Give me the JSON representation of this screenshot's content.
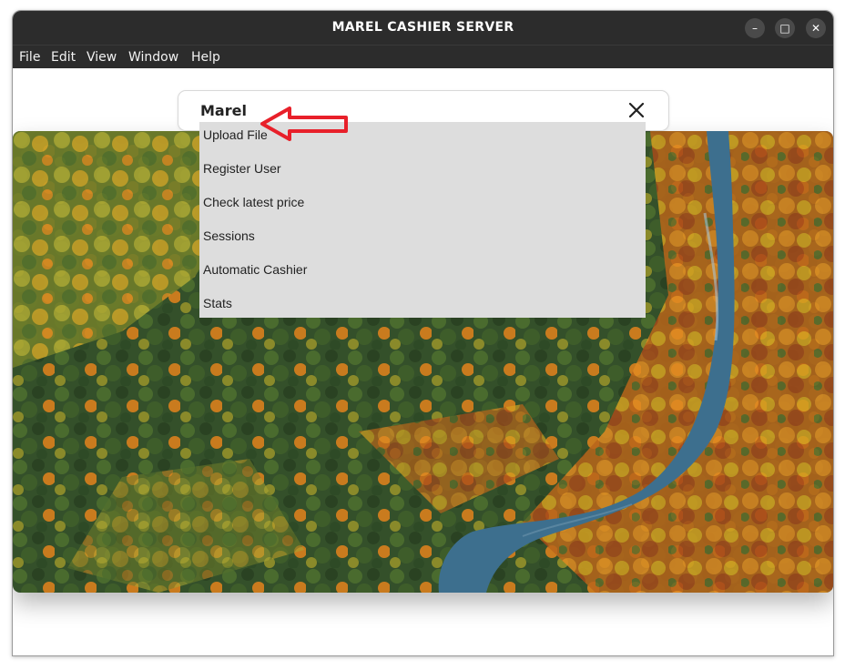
{
  "window": {
    "title": "MAREL CASHIER SERVER",
    "controls": {
      "minimize": "–",
      "maximize": "□",
      "close": "✕"
    }
  },
  "menubar": {
    "items": [
      "File",
      "Edit",
      "View",
      "Window",
      "Help"
    ]
  },
  "search": {
    "value": "Marel",
    "clear_icon": "close-icon"
  },
  "dropdown": {
    "items": [
      "Upload File",
      "Register User",
      "Check latest price",
      "Sessions",
      "Automatic Cashier",
      "Stats"
    ]
  },
  "annotation": {
    "arrow_color": "#e8202a",
    "points_to": "Upload File"
  },
  "colors": {
    "titlebar": "#2c2c2c",
    "dropdown_bg": "#dddddd",
    "river": "#3d6f8e"
  }
}
